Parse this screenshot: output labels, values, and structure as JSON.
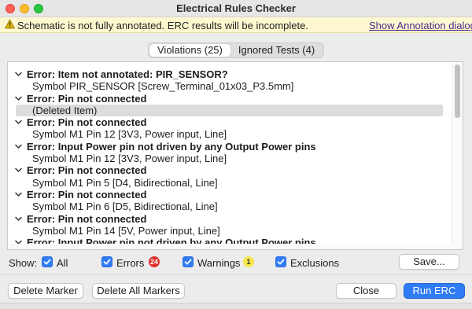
{
  "window": {
    "title": "Electrical Rules Checker"
  },
  "infobar": {
    "message": "Schematic is not fully annotated. ERC results will be incomplete.",
    "link": "Show Annotation dialog"
  },
  "tabs": [
    {
      "label": "Violations (25)",
      "active": true
    },
    {
      "label": "Ignored Tests (4)",
      "active": false
    }
  ],
  "violations": [
    {
      "type": "error",
      "label": "Error: Item not annotated: PIR_SENSOR?"
    },
    {
      "type": "item",
      "label": "Symbol PIR_SENSOR [Screw_Terminal_01x03_P3.5mm]"
    },
    {
      "type": "error",
      "label": "Error: Pin not connected"
    },
    {
      "type": "item",
      "label": "(Deleted Item)",
      "selected": true
    },
    {
      "type": "error",
      "label": "Error: Pin not connected"
    },
    {
      "type": "item",
      "label": "Symbol M1 Pin 12 [3V3, Power input, Line]"
    },
    {
      "type": "error",
      "label": "Error: Input Power pin not driven by any Output Power pins"
    },
    {
      "type": "item",
      "label": "Symbol M1 Pin 12 [3V3, Power input, Line]"
    },
    {
      "type": "error",
      "label": "Error: Pin not connected"
    },
    {
      "type": "item",
      "label": "Symbol M1 Pin 5 [D4, Bidirectional, Line]"
    },
    {
      "type": "error",
      "label": "Error: Pin not connected"
    },
    {
      "type": "item",
      "label": "Symbol M1 Pin 6 [D5, Bidirectional, Line]"
    },
    {
      "type": "error",
      "label": "Error: Pin not connected"
    },
    {
      "type": "item",
      "label": "Symbol M1 Pin 14 [5V, Power input, Line]"
    },
    {
      "type": "error",
      "label": "Error: Input Power pin not driven by any Output Power pins"
    }
  ],
  "filters": {
    "show_label": "Show:",
    "all": "All",
    "errors": "Errors",
    "errors_count": "24",
    "warnings": "Warnings",
    "warnings_count": "1",
    "exclusions": "Exclusions",
    "save": "Save..."
  },
  "footer": {
    "delete_marker": "Delete Marker",
    "delete_all": "Delete All Markers",
    "close": "Close",
    "run": "Run ERC"
  },
  "colors": {
    "accent": "#2f7cf6",
    "error_badge": "#e0302a",
    "warning_badge": "#f6e64a",
    "infobar": "#fdf8cf"
  }
}
